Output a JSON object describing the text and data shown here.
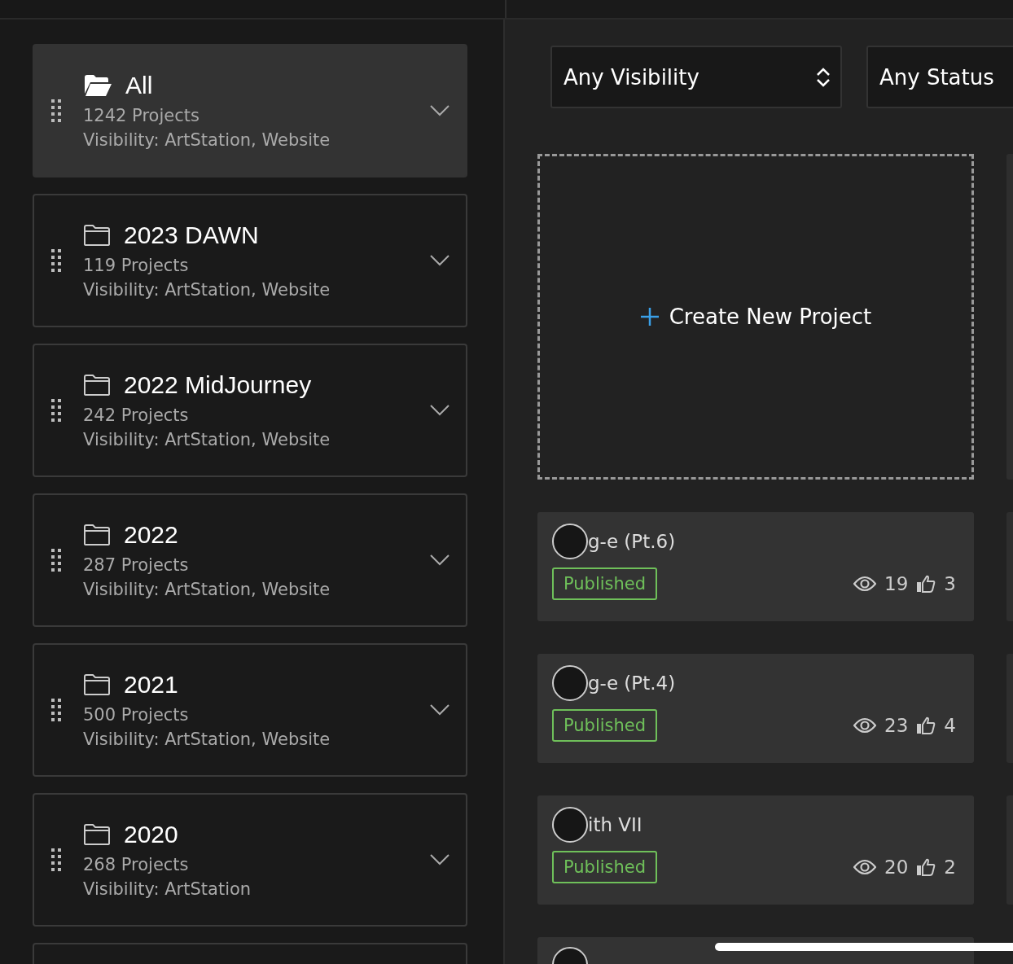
{
  "collections": [
    {
      "name": "All",
      "count": "1242 Projects",
      "visibility": "Visibility: ArtStation, Website",
      "selected": true
    },
    {
      "name": "2023 DAWN",
      "count": "119 Projects",
      "visibility": "Visibility: ArtStation, Website",
      "selected": false
    },
    {
      "name": "2022 MidJourney",
      "count": "242 Projects",
      "visibility": "Visibility: ArtStation, Website",
      "selected": false
    },
    {
      "name": "2022",
      "count": "287 Projects",
      "visibility": "Visibility: ArtStation, Website",
      "selected": false
    },
    {
      "name": "2021",
      "count": "500 Projects",
      "visibility": "Visibility: ArtStation, Website",
      "selected": false
    },
    {
      "name": "2020",
      "count": "268 Projects",
      "visibility": "Visibility: ArtStation",
      "selected": false
    }
  ],
  "filters": [
    {
      "value": "Any Visibility"
    },
    {
      "value": "Any Status"
    }
  ],
  "create_label": "Create New Project",
  "projects": [
    {
      "title": "g-e (Pt.6)",
      "status": "Published",
      "views": "19",
      "likes": "3"
    },
    {
      "title": "g-e (Pt.4)",
      "status": "Published",
      "views": "23",
      "likes": "4"
    },
    {
      "title": "ith VII",
      "status": "Published",
      "views": "20",
      "likes": "2"
    }
  ]
}
